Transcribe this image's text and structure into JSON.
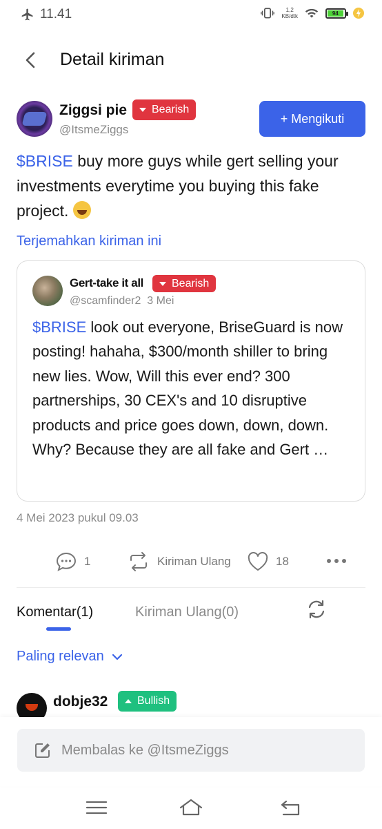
{
  "status_bar": {
    "time": "11.41",
    "net_speed_value": "1,2",
    "net_speed_unit": "KB/dtk",
    "battery": "94",
    "icons": [
      "airplane-icon",
      "vibrate-icon",
      "wifi-icon",
      "battery-icon",
      "charging-icon"
    ]
  },
  "header": {
    "title": "Detail kiriman"
  },
  "post": {
    "author_name": "Ziggsi pie",
    "author_handle": "@ItsmeZiggs",
    "sentiment": "Bearish",
    "follow_label": "+ Mengikuti",
    "ticker": "$BRISE",
    "text": " buy more guys while gert selling your investments everytime you buying this fake project. ",
    "translate_link": "Terjemahkan kiriman ini",
    "date": "4 Mei 2023 pukul 09.03"
  },
  "quoted_post": {
    "author_name": "Gert-take it all",
    "sentiment": "Bearish",
    "handle": "@scamfinder2",
    "date": "3 Mei",
    "ticker": "$BRISE",
    "text": " look out everyone, BriseGuard is now posting!  hahaha,  $300/month shiller to bring new lies.   Wow, Will this ever end?   300 partnerships, 30 CEX's and 10 disruptive products and price goes down, down, down.   Why?  Because they are all fake and Gert …"
  },
  "actions": {
    "comment_count": "1",
    "repost_label": "Kiriman Ulang",
    "like_count": "18"
  },
  "tabs": {
    "comments": "Komentar(1)",
    "reposts": "Kiriman Ulang(0)"
  },
  "sort": {
    "label": "Paling relevan"
  },
  "comment": {
    "author_name": "dobje32",
    "sentiment": "Bullish"
  },
  "reply": {
    "placeholder": "Membalas ke @ItsmeZiggs"
  },
  "colors": {
    "accent": "#3b63e8",
    "bearish": "#e0353f",
    "bullish": "#1fc07f"
  }
}
